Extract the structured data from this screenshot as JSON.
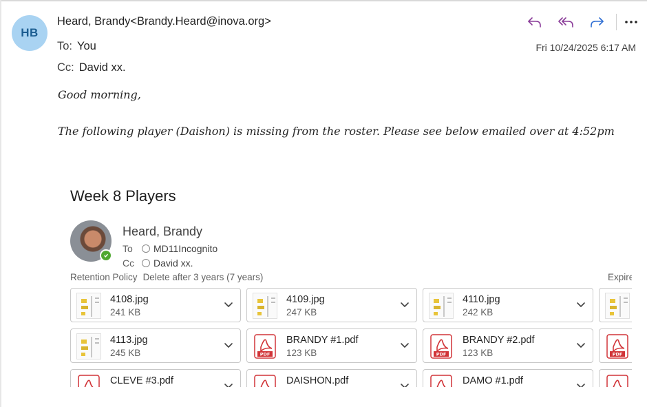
{
  "sender": {
    "initials": "HB",
    "display": "Heard, Brandy<Brandy.Heard@inova.org>"
  },
  "to": {
    "label": "To:",
    "value": "You"
  },
  "cc": {
    "label": "Cc:",
    "value": "David xx."
  },
  "date": "Fri 10/24/2025 6:17 AM",
  "actions": [
    "reply-icon",
    "reply-all-icon",
    "forward-icon",
    "more-icon"
  ],
  "colors": {
    "accent": "#8a3c99",
    "forward": "#2f6fd3",
    "avatar_bg": "#a9d3f2",
    "avatar_fg": "#1b5d91",
    "pdf": "#d13438"
  },
  "body": {
    "greeting": "Good morning,",
    "paragraph": "The following player (Daishon) is missing from the roster. Please see below emailed over at 4:52pm"
  },
  "embedded": {
    "title": "Week 8 Players",
    "sender_name": "Heard, Brandy",
    "to_label": "To",
    "to_value": "MD11Incognito",
    "cc_label": "Cc",
    "cc_value": "David xx.",
    "retention_label": "Retention Policy",
    "retention_value": "Delete after 3 years (7 years)",
    "expires_label": "Expire",
    "attachments": [
      {
        "name": "4108.jpg",
        "size": "241 KB",
        "type": "image"
      },
      {
        "name": "4109.jpg",
        "size": "247 KB",
        "type": "image"
      },
      {
        "name": "4110.jpg",
        "size": "242 KB",
        "type": "image"
      },
      {
        "name": "",
        "size": "",
        "type": "image"
      },
      {
        "name": "4113.jpg",
        "size": "245 KB",
        "type": "image"
      },
      {
        "name": "BRANDY #1.pdf",
        "size": "123 KB",
        "type": "pdf"
      },
      {
        "name": "BRANDY #2.pdf",
        "size": "123 KB",
        "type": "pdf"
      },
      {
        "name": "",
        "size": "",
        "type": "pdf"
      },
      {
        "name": "CLEVE #3.pdf",
        "size": "",
        "type": "pdf"
      },
      {
        "name": "DAISHON.pdf",
        "size": "",
        "type": "pdf"
      },
      {
        "name": "DAMO #1.pdf",
        "size": "",
        "type": "pdf"
      },
      {
        "name": "",
        "size": "",
        "type": "pdf"
      }
    ]
  }
}
